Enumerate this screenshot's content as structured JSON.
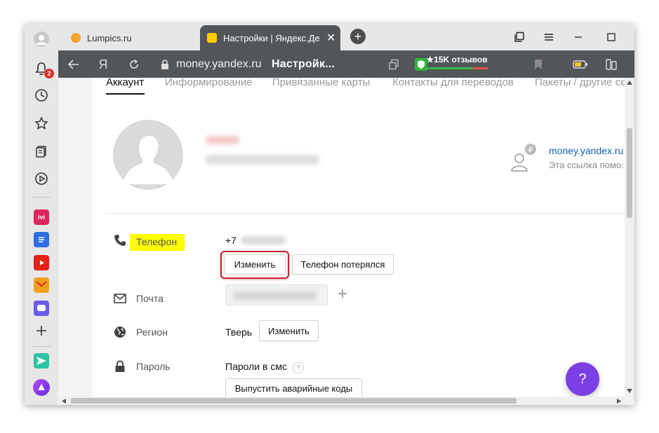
{
  "sidebar": {
    "notifications_count": "2",
    "apps": [
      {
        "name": "ivi",
        "label": "ivi",
        "color": "#e0245e"
      },
      {
        "name": "docs",
        "label": "",
        "color": "#2f6fe4"
      },
      {
        "name": "youtube",
        "label": "",
        "color": "#e62117"
      },
      {
        "name": "mail",
        "label": "",
        "color": "#f2a01b"
      },
      {
        "name": "messenger",
        "label": "",
        "color": "#6b5ce7"
      }
    ]
  },
  "tabs": [
    {
      "title": "Lumpics.ru",
      "favicon_color": "#f4a42c"
    },
    {
      "title": "Настройки | Яндекс.Де",
      "favicon_color": "#ffcc00",
      "close": "✕"
    }
  ],
  "toolbar": {
    "ya_letter": "Я",
    "domain": "money.yandex.ru",
    "page_title": "Настройк...",
    "reviews": "★15K отзывов"
  },
  "subnav": [
    "Аккаунт",
    "Информирование",
    "Привязанные карты",
    "Контакты для переводов",
    "Пакеты / другие сє"
  ],
  "profile_link": {
    "url": "money.yandex.ru",
    "hint": "Эта ссылка помо:"
  },
  "phone": {
    "label": "Телефон",
    "value": "+7",
    "change_btn": "Изменить",
    "lost_btn": "Телефон потерялся"
  },
  "email": {
    "label": "Почта",
    "add": "+"
  },
  "region": {
    "label": "Регион",
    "value": "Тверь",
    "change_btn": "Изменить"
  },
  "password": {
    "label": "Пароль",
    "value": "Пароли в смс",
    "hint": "?",
    "codes_btn": "Выпустить аварийные коды"
  },
  "help_label": "?",
  "colors": {
    "highlight": "#ffff00",
    "annotation": "#c4212b",
    "link": "#1a5fb4",
    "help": "#7b3fe4"
  }
}
